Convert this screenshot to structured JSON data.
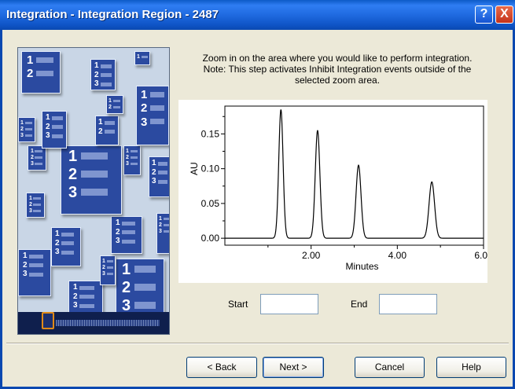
{
  "window": {
    "title": "Integration - Integration Region - 2487",
    "help_glyph": "?",
    "close_glyph": "X"
  },
  "instructions": {
    "line1": "Zoom in on the area where you would like to perform integration.",
    "line2": "Note: This step activates Inhibit Integration events outside of the",
    "line3": "selected zoom area."
  },
  "chart_data": {
    "type": "line",
    "xlabel": "Minutes",
    "ylabel": "AU",
    "xlim": [
      0,
      6.0
    ],
    "ylim": [
      -0.01,
      0.19
    ],
    "xticks": [
      2.0,
      4.0,
      6.0
    ],
    "xtick_labels": [
      "2.00",
      "4.00",
      "6.00"
    ],
    "yticks": [
      0.0,
      0.05,
      0.1,
      0.15
    ],
    "ytick_labels": [
      "0.00",
      "0.05",
      "0.10",
      "0.15"
    ],
    "grid": false,
    "series_color": "#000000",
    "baseline": 0.0,
    "peaks": [
      {
        "x": 1.3,
        "height": 0.185
      },
      {
        "x": 2.15,
        "height": 0.155
      },
      {
        "x": 3.1,
        "height": 0.105
      },
      {
        "x": 4.8,
        "height": 0.081
      }
    ]
  },
  "range": {
    "start_label": "Start",
    "start_value": "",
    "end_label": "End",
    "end_value": ""
  },
  "buttons": {
    "back": "< Back",
    "next": "Next >",
    "cancel": "Cancel",
    "help": "Help"
  },
  "colors": {
    "title_bar": "#2f7df2",
    "dialog_bg": "#ece9d8",
    "art_doc": "#2b4aa0"
  }
}
